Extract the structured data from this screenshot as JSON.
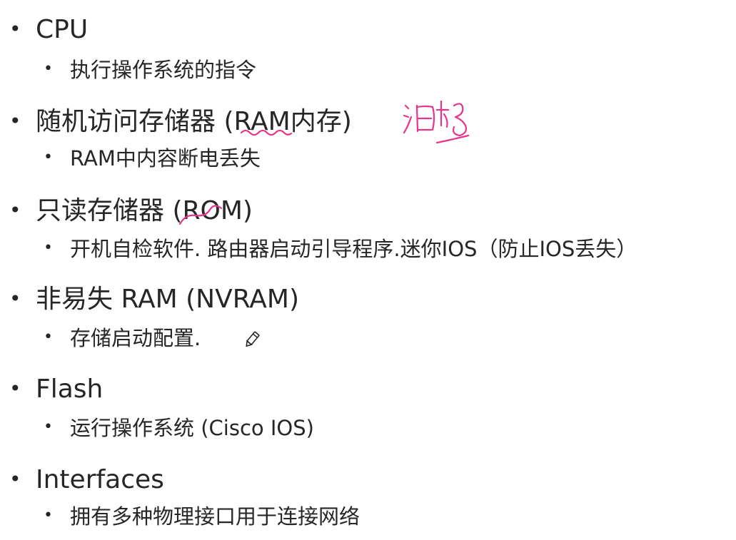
{
  "colors": {
    "text": "#262626",
    "ink": "#e8358a",
    "background": "#ffffff"
  },
  "items": [
    {
      "title": "CPU",
      "sub": "执行操作系统的指令"
    },
    {
      "title": "随机访问存储器 (RAM内存)",
      "sub": "RAM中内容断电丢失"
    },
    {
      "title": "只读存储器 (ROM)",
      "sub": "开机自检软件. 路由器启动引导程序.迷你IOS（防止IOS丢失）"
    },
    {
      "title": "非易失 RAM (NVRAM)",
      "sub": "存储启动配置."
    },
    {
      "title": "Flash",
      "sub": "运行操作系统 (Cisco IOS)"
    },
    {
      "title": "Interfaces",
      "sub": "拥有多种物理接口用于连接网络"
    }
  ],
  "bullet_glyph": "•",
  "icons": {
    "edit_marker": "pencil-icon"
  }
}
